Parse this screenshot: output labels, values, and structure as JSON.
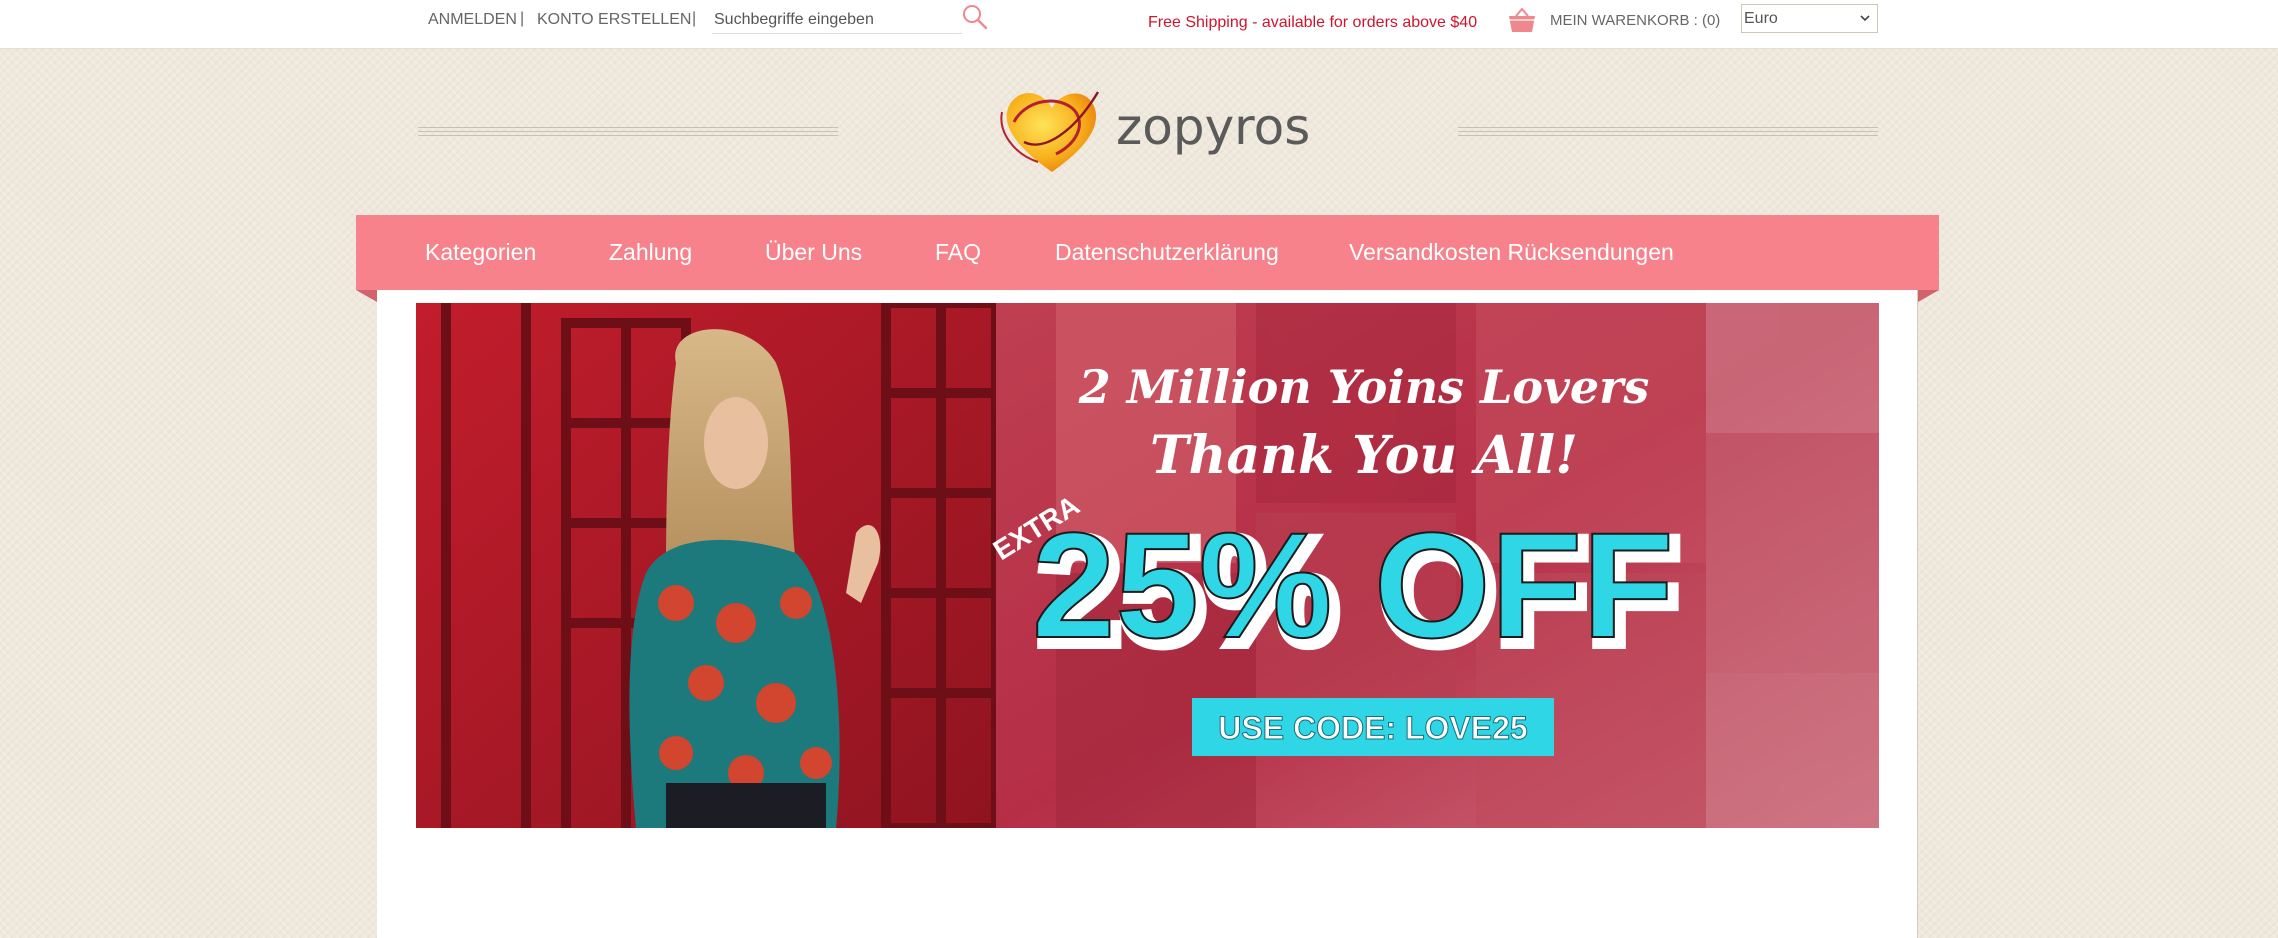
{
  "topbar": {
    "login": "ANMELDEN",
    "register": "KONTO ERSTELLEN",
    "separator": "|",
    "search_placeholder": "Suchbegriffe eingeben",
    "shipping_notice": "Free Shipping - available for orders above $40",
    "cart_label": "MEIN WARENKORB : (0)",
    "currency_selected": "Euro"
  },
  "brand": {
    "name": "zopyros"
  },
  "nav": {
    "items": [
      {
        "label": "Kategorien"
      },
      {
        "label": "Zahlung"
      },
      {
        "label": "Über Uns"
      },
      {
        "label": "FAQ"
      },
      {
        "label": "Datenschutzerklärung"
      },
      {
        "label": "Versandkosten Rücksendungen"
      }
    ]
  },
  "banner": {
    "headline_line1": "2 Million Yoins Lovers",
    "headline_line2": "Thank You All!",
    "extra": "EXTRA",
    "discount": "25% OFF",
    "code": "USE CODE: LOVE25"
  },
  "colors": {
    "nav_bg": "#f7828b",
    "shipping_text": "#d0142d",
    "banner_accent": "#2ed6e6",
    "page_bg": "#efe8dc"
  },
  "icons": {
    "search": "search-icon",
    "cart": "basket-icon",
    "dropdown": "chevron-down-icon"
  }
}
